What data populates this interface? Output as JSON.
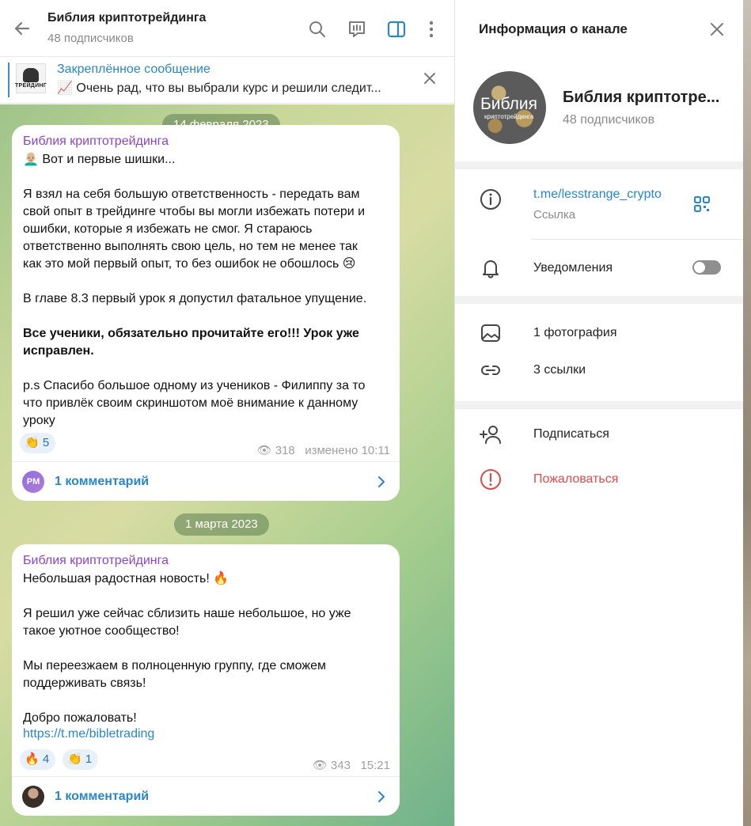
{
  "header": {
    "title": "Библия криптотрейдинга",
    "subscribers": "48 подписчиков"
  },
  "pinned": {
    "title": "Закреплённое сообщение",
    "text": "📈 Очень рад, что вы выбрали курс и решили следит...",
    "thumb_text": "ТРЕЙДИНГ"
  },
  "messages": [
    {
      "date": "14 февраля 2023",
      "author": "Библия криптотрейдинга",
      "lines": [
        {
          "text": "👨🏼‍🦲 Вот и первые шишки...",
          "bold": false
        },
        {
          "text": "",
          "bold": false
        },
        {
          "text": "Я взял на себя большую ответственность - передать вам",
          "bold": false
        },
        {
          "text": "свой опыт в трейдинге чтобы вы могли избежать потери и",
          "bold": false
        },
        {
          "text": "ошибки, которые я избежать не смог. Я стараюсь",
          "bold": false
        },
        {
          "text": "ответственно выполнять свою цель, но тем не менее так",
          "bold": false
        },
        {
          "text": "как это мой первый опыт, то без ошибок не обошлось 😢",
          "bold": false
        },
        {
          "text": "",
          "bold": false
        },
        {
          "text": "В главе 8.3 первый урок я допустил фатальное упущение.",
          "bold": false
        },
        {
          "text": "",
          "bold": false
        },
        {
          "text": "Все ученики, обязательно прочитайте его!!! Урок уже",
          "bold": true
        },
        {
          "text": "исправлен.",
          "bold": true
        },
        {
          "text": "",
          "bold": false
        },
        {
          "text": "p.s Спасибо большое одному из учеников - Филиппу за то",
          "bold": false
        },
        {
          "text": "что привлёк своим скриншотом моё внимание к данному",
          "bold": false
        },
        {
          "text": "уроку",
          "bold": false
        }
      ],
      "reactions": [
        {
          "emoji": "👏",
          "count": "5"
        }
      ],
      "views": "318",
      "time": "изменено 10:11",
      "comment_avatar": "PM",
      "comments": "1 комментарий"
    },
    {
      "date": "1 марта 2023",
      "author": "Библия криптотрейдинга",
      "lines": [
        {
          "text": "Небольшая радостная новость! 🔥",
          "bold": false
        },
        {
          "text": "",
          "bold": false
        },
        {
          "text": "Я решил уже сейчас сблизить наше небольшое, но уже",
          "bold": false
        },
        {
          "text": "такое уютное сообщество!",
          "bold": false
        },
        {
          "text": "",
          "bold": false
        },
        {
          "text": "Мы переезжаем в полноценную группу, где сможем",
          "bold": false
        },
        {
          "text": "поддерживать связь!",
          "bold": false
        },
        {
          "text": "",
          "bold": false
        },
        {
          "text": "Добро пожаловать!",
          "bold": false
        }
      ],
      "link": "https://t.me/bibletrading",
      "reactions": [
        {
          "emoji": "🔥",
          "count": "4"
        },
        {
          "emoji": "👏",
          "count": "1"
        }
      ],
      "views": "343",
      "time": "15:21",
      "comments": "1 комментарий"
    }
  ],
  "panel": {
    "title": "Информация о канале",
    "avatar_title": "Библия",
    "avatar_sub": "криптотрейдинга",
    "name": "Библия криптотре...",
    "subscribers": "48 подписчиков",
    "link": "t.me/lesstrange_crypto",
    "link_caption": "Ссылка",
    "notifications": "Уведомления",
    "notifications_on": false,
    "photos": "1 фотография",
    "links": "3 ссылки",
    "subscribe": "Подписаться",
    "report": "Пожаловаться"
  },
  "colors": {
    "accent": "#2a86c8",
    "author": "#8e44c4",
    "danger": "#dd4b4b"
  }
}
